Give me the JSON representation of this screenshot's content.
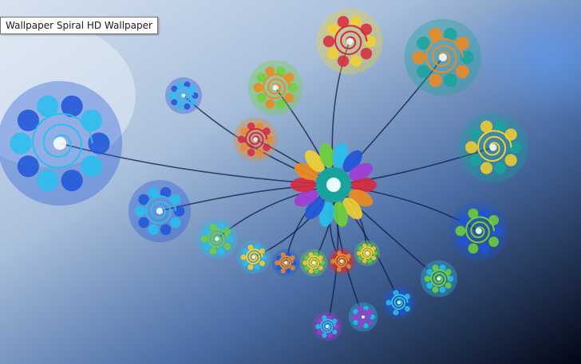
{
  "tooltip": {
    "text": "Wallpaper Spiral HD Wallpaper"
  },
  "image": {
    "subject": "fractal-spiral-peacock",
    "palette": {
      "bg_light": "#c9d6e6",
      "bg_mid": "#5d7fb0",
      "bg_dark": "#030818",
      "blue": "#1f56d8",
      "cyan": "#28c0ee",
      "teal": "#18a49c",
      "green": "#6fd13a",
      "yellow": "#f2d030",
      "orange": "#f08a1c",
      "red": "#d8283a",
      "magenta": "#a13bd6",
      "stem": "#101b44"
    }
  }
}
